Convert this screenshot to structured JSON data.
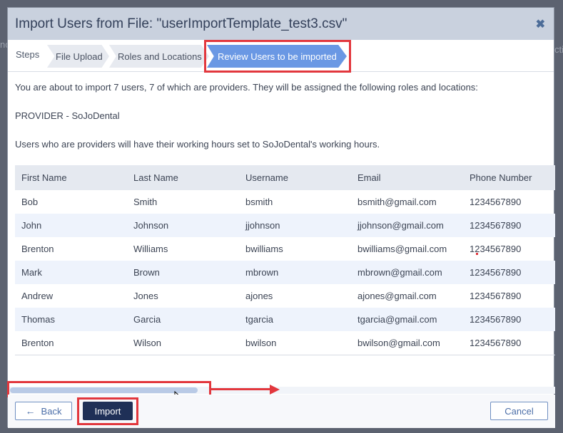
{
  "background": {
    "left_fragment": "nc",
    "right_fragment": "ctiv"
  },
  "dialog": {
    "title": "Import Users from File: \"userImportTemplate_test3.csv\"",
    "close_icon": "close-icon"
  },
  "steps": {
    "label": "Steps",
    "items": [
      {
        "label": "File Upload",
        "active": false
      },
      {
        "label": "Roles and Locations",
        "active": false
      },
      {
        "label": "Review Users to be imported",
        "active": true
      }
    ]
  },
  "content": {
    "intro": "You are about to import 7 users, 7 of which are providers. They will be assigned the following roles and locations:",
    "role_location": "PROVIDER - SoJoDental",
    "hours_note": "Users who are providers will have their working hours set to SoJoDental's working hours."
  },
  "table": {
    "columns": [
      "First Name",
      "Last Name",
      "Username",
      "Email",
      "Phone Number"
    ],
    "rows": [
      [
        "Bob",
        "Smith",
        "bsmith",
        "bsmith@gmail.com",
        "1234567890"
      ],
      [
        "John",
        "Johnson",
        "jjohnson",
        "jjohnson@gmail.com",
        "1234567890"
      ],
      [
        "Brenton",
        "Williams",
        "bwilliams",
        "bwilliams@gmail.com",
        "1234567890"
      ],
      [
        "Mark",
        "Brown",
        "mbrown",
        "mbrown@gmail.com",
        "1234567890"
      ],
      [
        "Andrew",
        "Jones",
        "ajones",
        "ajones@gmail.com",
        "1234567890"
      ],
      [
        "Thomas",
        "Garcia",
        "tgarcia",
        "tgarcia@gmail.com",
        "1234567890"
      ],
      [
        "Brenton",
        "Wilson",
        "bwilson",
        "bwilson@gmail.com",
        "1234567890"
      ]
    ]
  },
  "footer": {
    "back_label": "Back",
    "back_icon": "arrow-left-icon",
    "import_label": "Import",
    "cancel_label": "Cancel"
  },
  "colors": {
    "title_bar": "#c9d1de",
    "active_step": "#6a98e4",
    "primary_button": "#1f3057",
    "highlight": "#e2373d",
    "row_alt": "#eef3fc"
  }
}
